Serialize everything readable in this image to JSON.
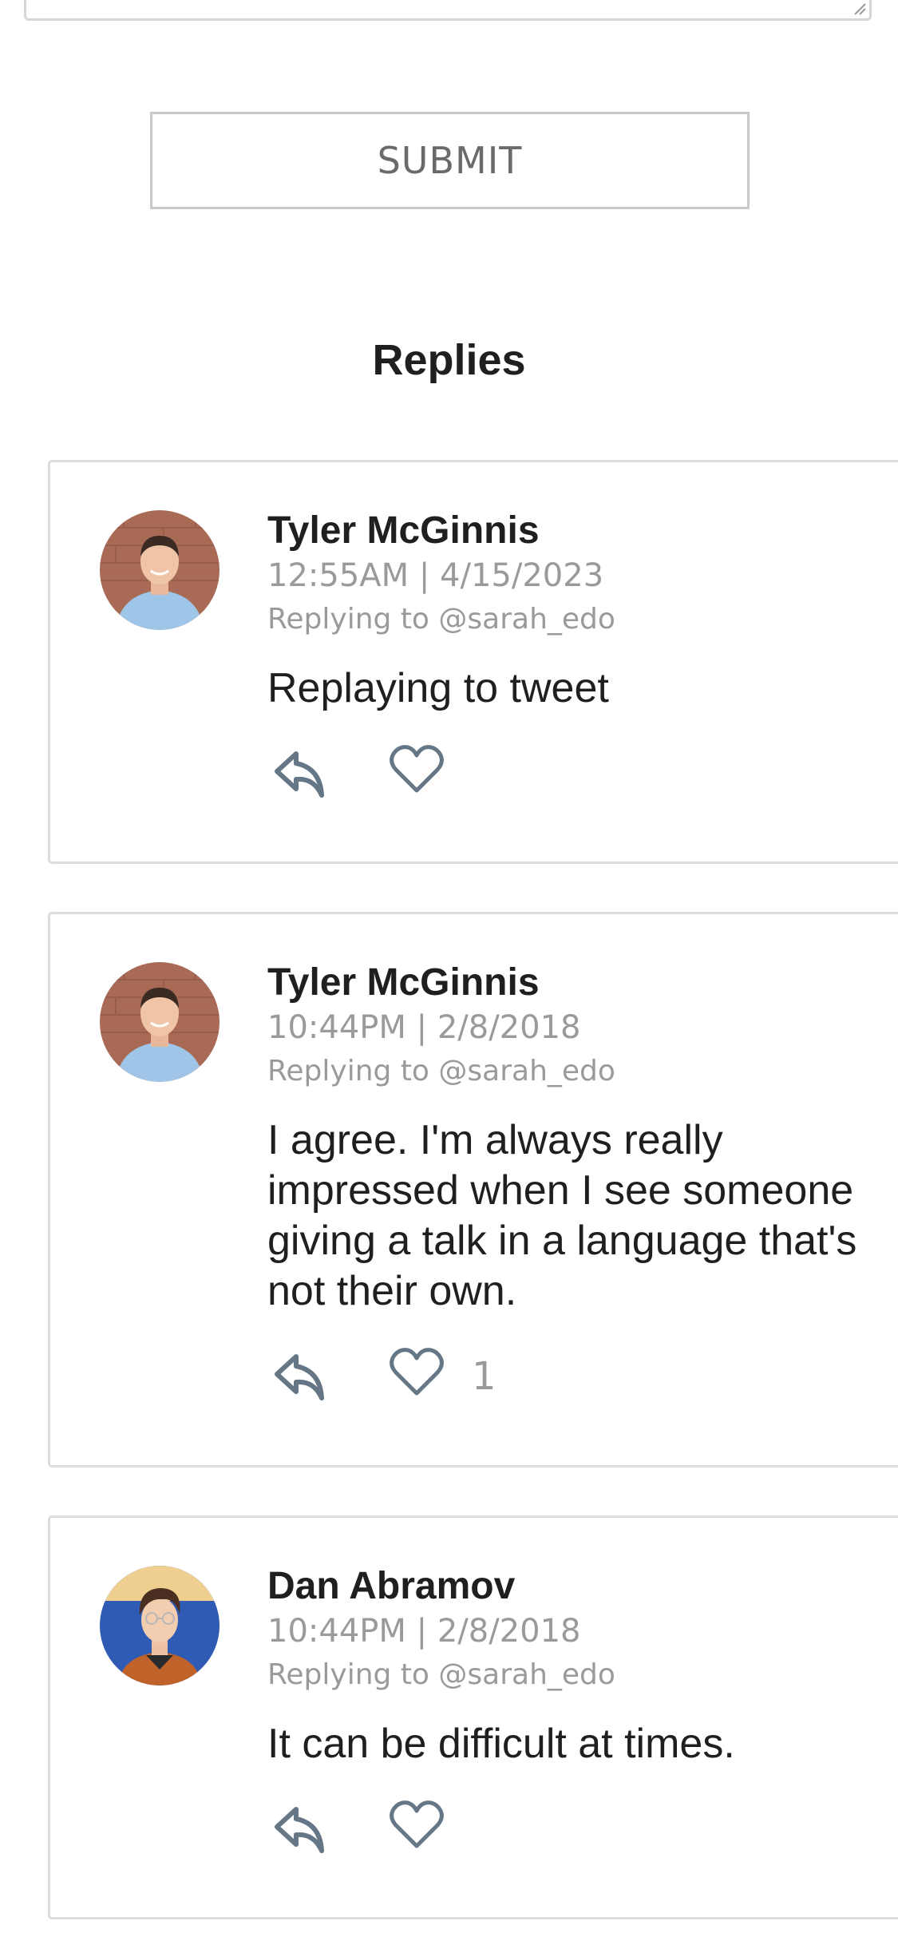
{
  "form": {
    "submit_label": "SUBMIT"
  },
  "replies_heading": "Replies",
  "replies": [
    {
      "author": "Tyler McGinnis",
      "timestamp": "12:55AM | 4/15/2023",
      "replying_to": "Replying to @sarah_edo",
      "text": "Replaying to tweet",
      "likes": ""
    },
    {
      "author": "Tyler McGinnis",
      "timestamp": "10:44PM | 2/8/2018",
      "replying_to": "Replying to @sarah_edo",
      "text": "I agree. I'm always really impressed when I see someone giving a talk in a language that's not their own.",
      "likes": "1"
    },
    {
      "author": "Dan Abramov",
      "timestamp": "10:44PM | 2/8/2018",
      "replying_to": "Replying to @sarah_edo",
      "text": "It can be difficult at times.",
      "likes": ""
    }
  ],
  "icons": {
    "reply": "reply-arrow-icon",
    "like": "heart-outline-icon"
  },
  "colors": {
    "icon_stroke": "#657786",
    "meta_text": "#9a9a9a",
    "card_border": "#dcdcdc"
  }
}
